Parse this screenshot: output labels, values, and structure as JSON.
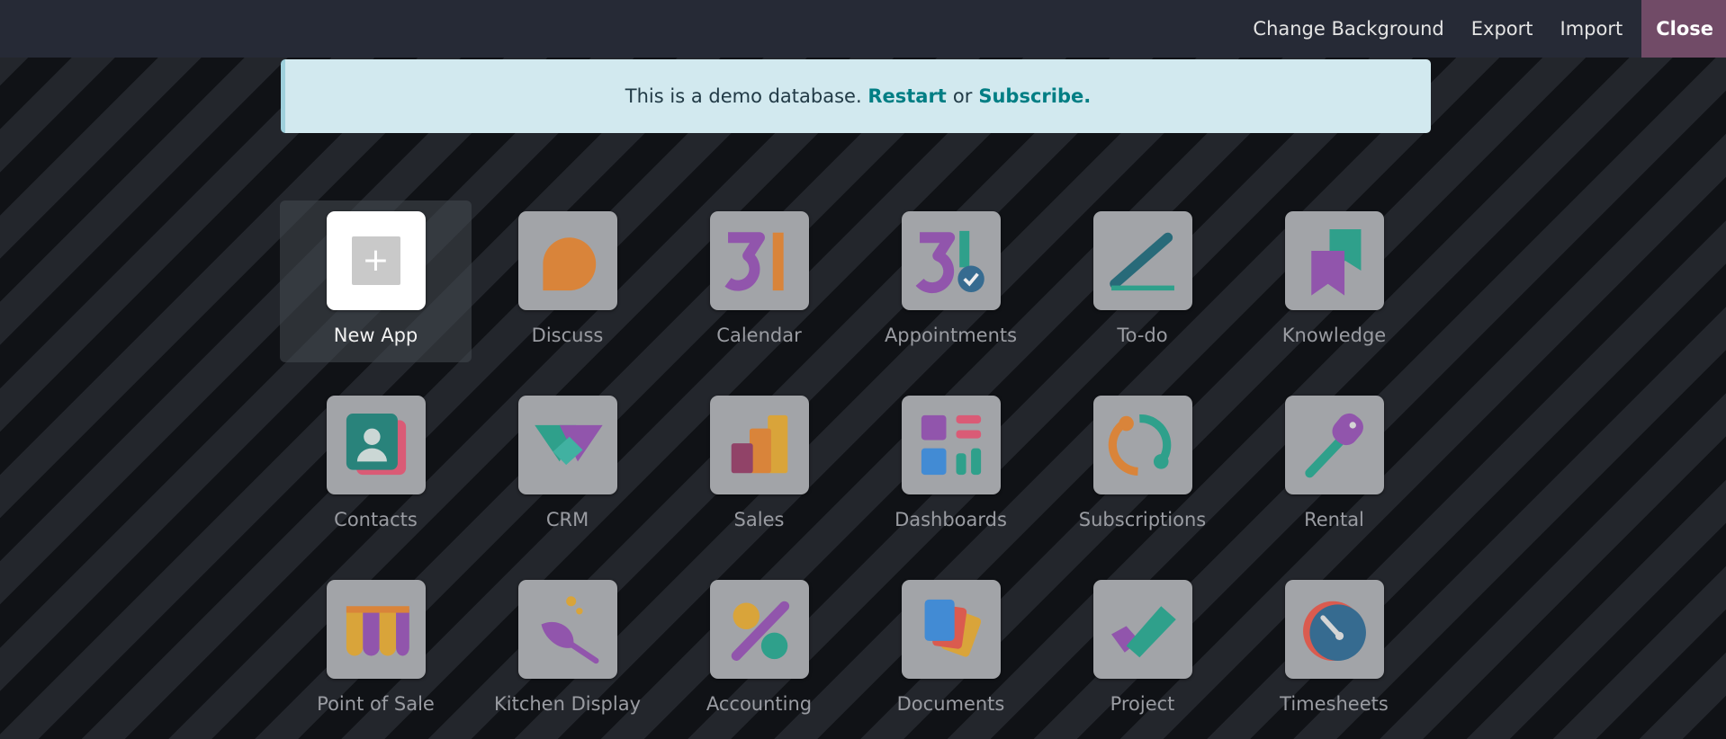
{
  "topbar": {
    "change_background": "Change Background",
    "export": "Export",
    "import": "Import",
    "close": "Close"
  },
  "banner": {
    "text": "This is a demo database.",
    "restart": "Restart",
    "or": "or",
    "subscribe": "Subscribe."
  },
  "apps": [
    {
      "label": "New App",
      "icon": "plus-icon"
    },
    {
      "label": "Discuss",
      "icon": "discuss-icon"
    },
    {
      "label": "Calendar",
      "icon": "calendar-icon"
    },
    {
      "label": "Appointments",
      "icon": "appointments-icon"
    },
    {
      "label": "To-do",
      "icon": "todo-icon"
    },
    {
      "label": "Knowledge",
      "icon": "knowledge-icon"
    },
    {
      "label": "Contacts",
      "icon": "contacts-icon"
    },
    {
      "label": "CRM",
      "icon": "crm-icon"
    },
    {
      "label": "Sales",
      "icon": "sales-icon"
    },
    {
      "label": "Dashboards",
      "icon": "dashboards-icon"
    },
    {
      "label": "Subscriptions",
      "icon": "subscriptions-icon"
    },
    {
      "label": "Rental",
      "icon": "rental-icon"
    },
    {
      "label": "Point of Sale",
      "icon": "point-of-sale-icon"
    },
    {
      "label": "Kitchen Display",
      "icon": "kitchen-display-icon"
    },
    {
      "label": "Accounting",
      "icon": "accounting-icon"
    },
    {
      "label": "Documents",
      "icon": "documents-icon"
    },
    {
      "label": "Project",
      "icon": "project-icon"
    },
    {
      "label": "Timesheets",
      "icon": "timesheets-icon"
    }
  ],
  "colors": {
    "topbar_bg": "#262a36",
    "close_bg": "#714b67",
    "banner_bg": "#d2e9ef",
    "banner_link": "#017e84"
  }
}
